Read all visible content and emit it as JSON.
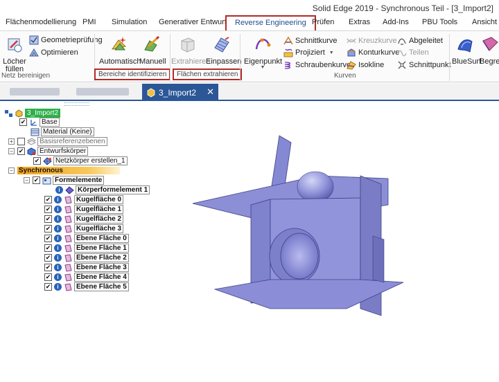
{
  "window": {
    "title": "Solid Edge 2019 - Synchronous Teil - [3_Import2]"
  },
  "menu": {
    "items": [
      "Flächenmodellierung",
      "PMI",
      "Simulation",
      "Generativer Entwurf",
      "Reverse Engineering",
      "Prüfen",
      "Extras",
      "Add-Ins",
      "PBU Tools",
      "Ansicht"
    ],
    "active": "Reverse Engineering"
  },
  "ribbon": {
    "netz": {
      "fill_line1": "Löcher",
      "fill_line2": "füllen",
      "check": "Geometrieprüfung",
      "optimize": "Optimieren",
      "group": "Netz bereinigen"
    },
    "bereiche": {
      "auto": "Automatisch",
      "manual": "Manuell",
      "group": "Bereiche identifizieren"
    },
    "flaechen": {
      "extract": "Extrahieren",
      "fit": "Einpassen",
      "group": "Flächen extrahieren"
    },
    "kurven": {
      "eigenpunkt": "Eigenpunkt",
      "schnittkurve": "Schnittkurve",
      "projiziert": "Projiziert",
      "schraubenkurve": "Schraubenkurve",
      "kreuzkurve": "Kreuzkurve",
      "konturkurve": "Konturkurve",
      "isokline": "Isokline",
      "abgeleitet": "Abgeleitet",
      "teilen": "Teilen",
      "schnittpunkt": "Schnittpunkt",
      "group": "Kurven"
    },
    "surf": {
      "bluesurf": "BlueSurf",
      "begrenzt": "Begre"
    }
  },
  "tabs": {
    "active_label": "3_Import2",
    "close": "✕"
  },
  "tree": {
    "root": "3_Import2",
    "base": "Base",
    "material": "Material (Keine)",
    "basisref": "Basisreferenzebenen",
    "entwurf": "Entwurfskörper",
    "netz": "Netzkörper erstellen_1",
    "sync": "Synchronous",
    "formelemente": "Formelemente",
    "koerperformelement": "Körperformelement 1",
    "faces": [
      "Kugelfläche 0",
      "Kugelfläche 1",
      "Kugelfläche 2",
      "Kugelfläche 3",
      "Ebene Fläche 0",
      "Ebene Fläche 1",
      "Ebene Fläche 2",
      "Ebene Fläche 3",
      "Ebene Fläche 4",
      "Ebene Fläche 5"
    ]
  },
  "colors": {
    "accent": "#2b5797",
    "highlight_box": "#b22a2a",
    "model_fill": "#8c8fd6",
    "model_edge": "#3c3f86"
  }
}
